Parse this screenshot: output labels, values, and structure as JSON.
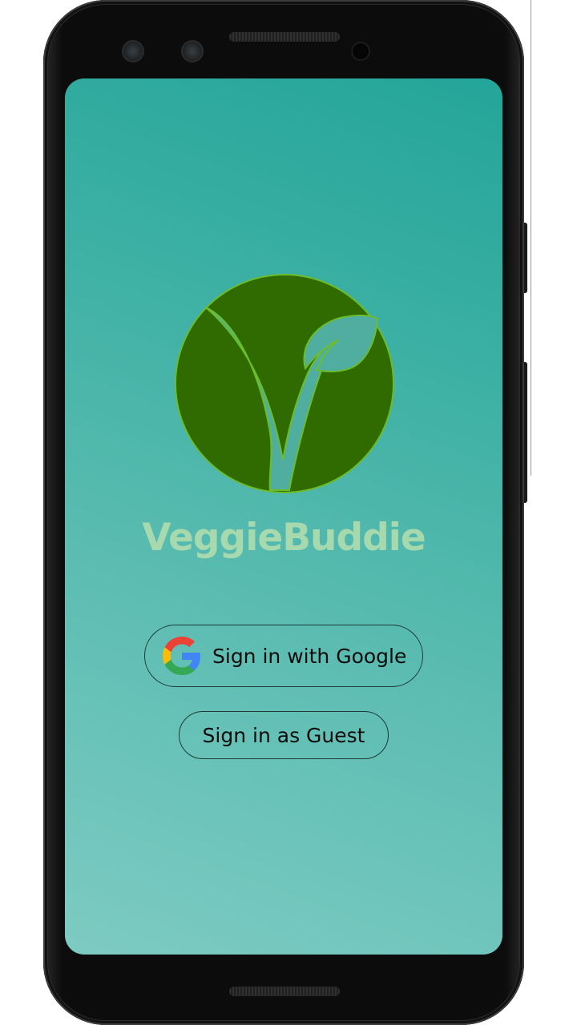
{
  "app": {
    "title": "VeggieBuddie"
  },
  "buttons": {
    "google_label": "Sign in with Google",
    "guest_label": "Sign in as Guest"
  },
  "icons": {
    "logo": "veggie-v-leaf-logo",
    "google": "google-g-icon"
  },
  "colors": {
    "screen_gradient_top": "#24a599",
    "screen_gradient_bottom": "#7dcbc2",
    "logo_fill": "#2f6b00",
    "logo_accent": "#4fae9f",
    "title": "#a6d9ad",
    "button_border": "#1f3a36"
  }
}
